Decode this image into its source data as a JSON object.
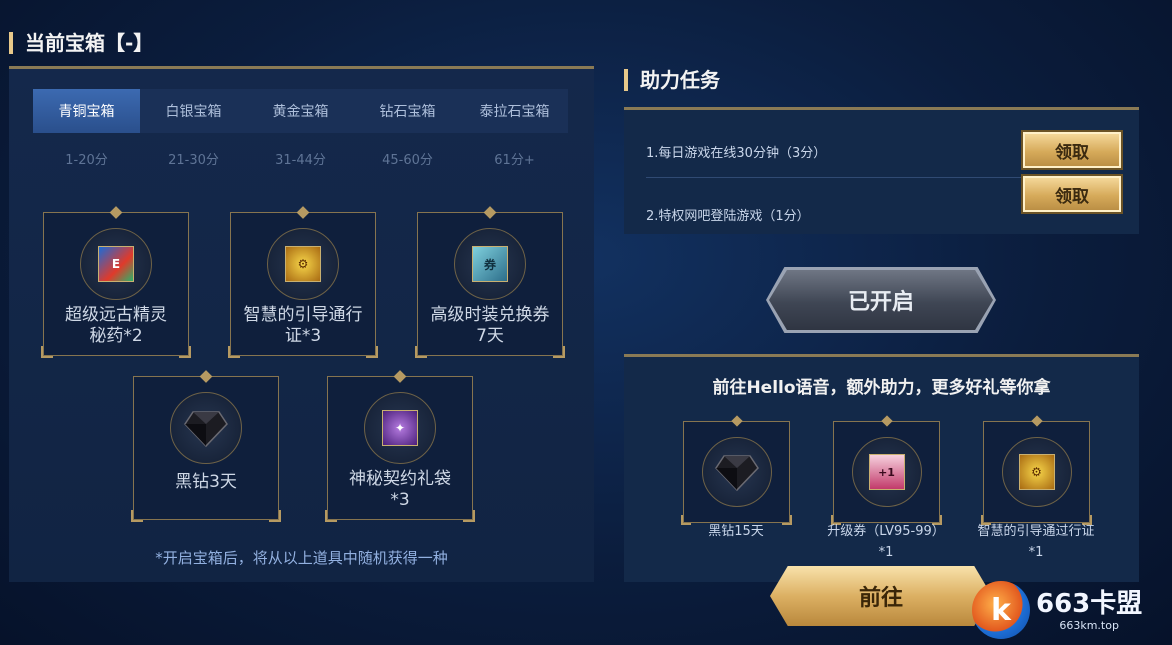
{
  "left": {
    "title": "当前宝箱【-】",
    "tabs": [
      "青铜宝箱",
      "白银宝箱",
      "黄金宝箱",
      "钻石宝箱",
      "泰拉石宝箱"
    ],
    "active_tab": 0,
    "ranges": [
      "1-20分",
      "21-30分",
      "31-44分",
      "45-60分",
      "61分+"
    ],
    "items": [
      {
        "label_line1": "超级远古精灵",
        "label_line2": "秘药*2",
        "icon": "potion-icon"
      },
      {
        "label_line1": "智慧的引导通行",
        "label_line2": "证*3",
        "icon": "pass-icon"
      },
      {
        "label_line1": "高级时装兑换券",
        "label_line2": "7天",
        "icon": "coupon-icon"
      },
      {
        "label_line1": "黑钻3天",
        "label_line2": "",
        "icon": "black-diamond-icon"
      },
      {
        "label_line1": "神秘契约礼袋",
        "label_line2": "*3",
        "icon": "gift-bag-icon"
      }
    ],
    "note": "*开启宝箱后，将从以上道具中随机获得一种"
  },
  "right": {
    "title": "助力任务",
    "tasks": [
      {
        "text": "1.每日游戏在线30分钟（3分）",
        "button": "领取"
      },
      {
        "text": "2.特权网吧登陆游戏（1分）",
        "button": "领取"
      }
    ],
    "open_button": "已开启",
    "hello": {
      "title": "前往Hello语音，额外助力，更多好礼等你拿",
      "items": [
        {
          "line1": "黑钻15天",
          "line2": "",
          "icon": "black-diamond-icon"
        },
        {
          "line1": "升级券（LV95-99）",
          "line2": "*1",
          "icon": "level-ticket-icon"
        },
        {
          "line1": "智慧的引导通过行证",
          "line2": "*1",
          "icon": "pass-icon"
        }
      ],
      "go_button": "前往"
    }
  },
  "watermark": {
    "name": "663卡盟",
    "url": "663km.top"
  },
  "colors": {
    "accent_gold": "#e8c98a",
    "active_tab": "#3c6ab1",
    "note_blue": "#92b0e0"
  }
}
